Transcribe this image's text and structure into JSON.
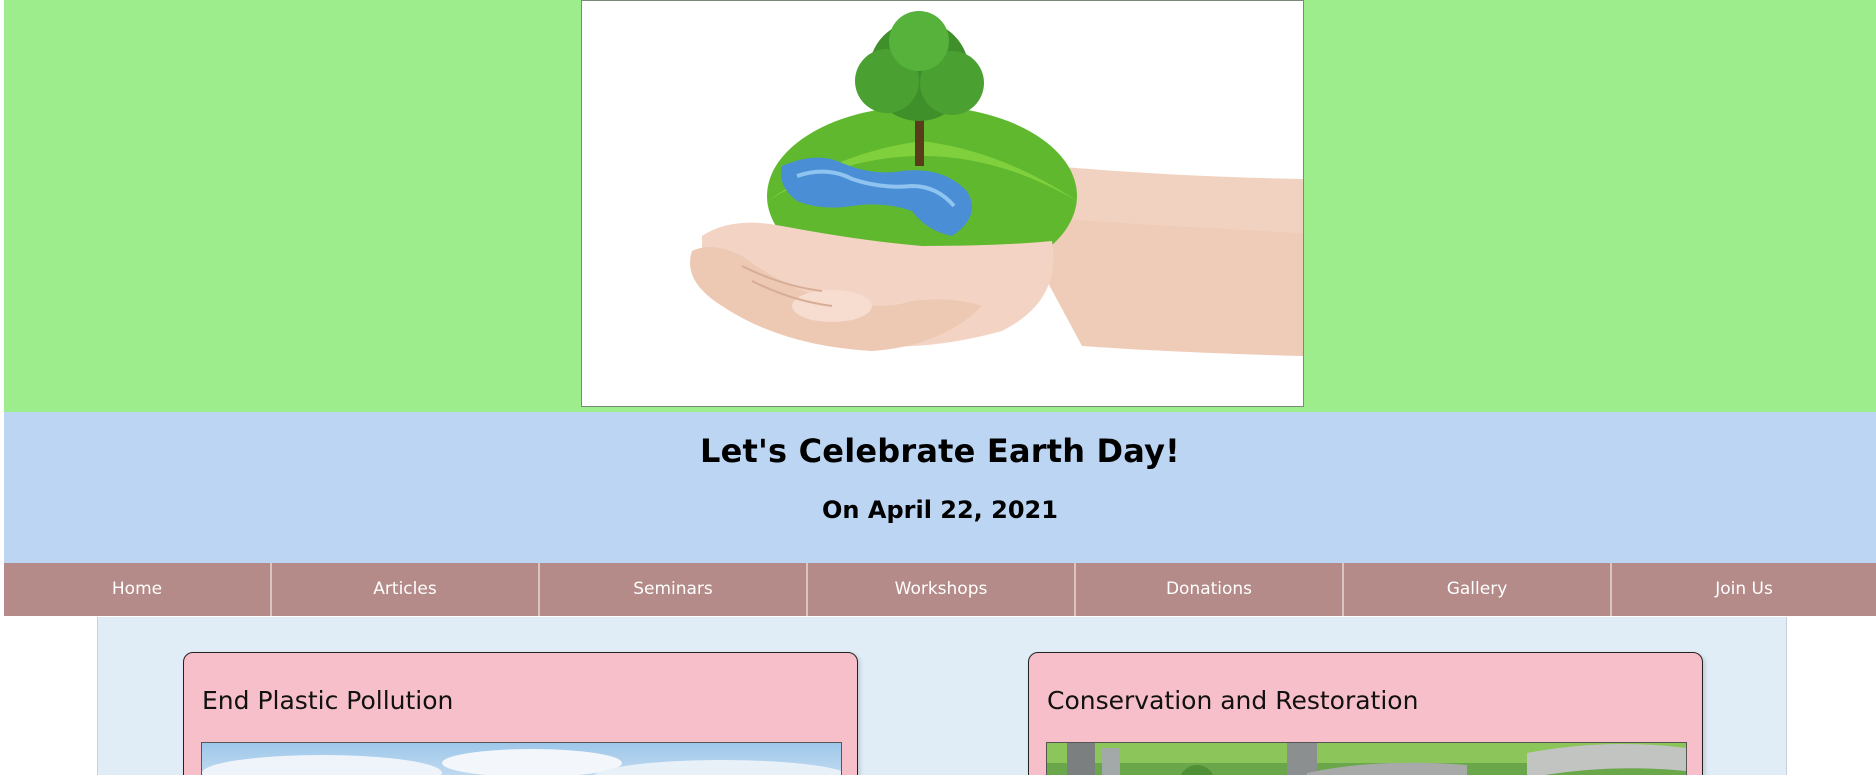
{
  "hero": {
    "image_alt": "hands holding a grassy half-globe with a tree",
    "background_color": "#9ded8c"
  },
  "banner": {
    "title": "Let's Celebrate Earth Day!",
    "date": "On April 22, 2021",
    "background_color": "#bcd5f2"
  },
  "nav": {
    "background_color": "#b48b88",
    "items": [
      {
        "label": "Home"
      },
      {
        "label": "Articles"
      },
      {
        "label": "Seminars"
      },
      {
        "label": "Workshops"
      },
      {
        "label": "Donations"
      },
      {
        "label": "Gallery"
      },
      {
        "label": "Join Us"
      }
    ]
  },
  "cards": [
    {
      "title": "End Plastic Pollution",
      "image_alt": "sky with clouds"
    },
    {
      "title": "Conservation and Restoration",
      "image_alt": "forest with fallen logs"
    }
  ],
  "colors": {
    "card_background": "#f7bfc9",
    "content_background": "#e0ecf6"
  }
}
